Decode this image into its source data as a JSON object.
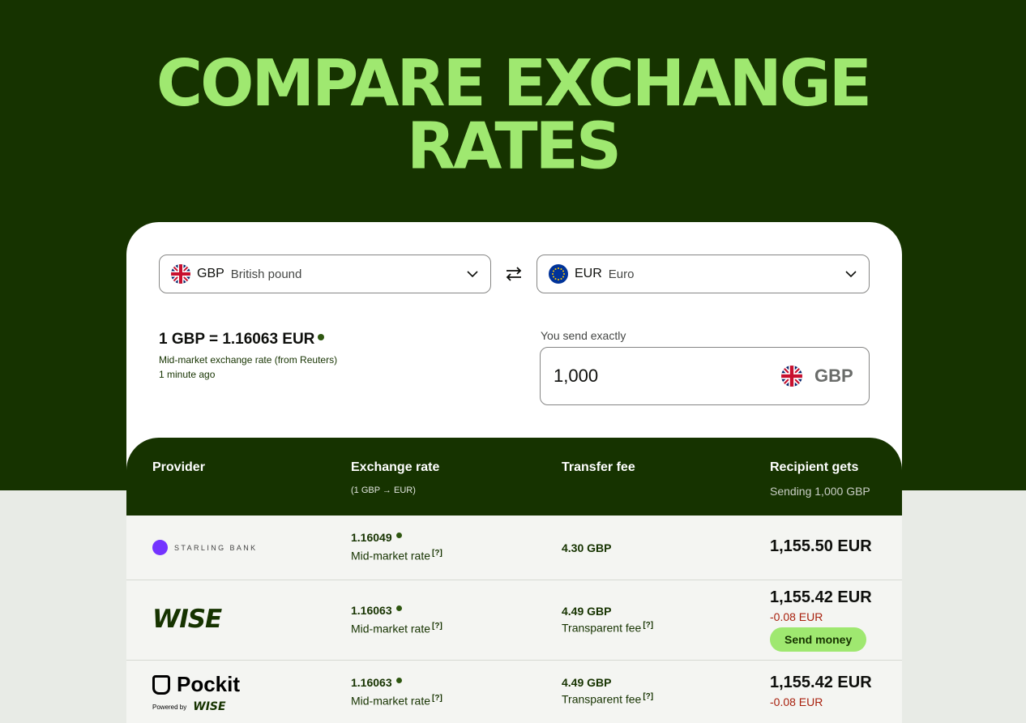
{
  "hero": {
    "title_line1": "COMPARE EXCHANGE",
    "title_line2": "RATES"
  },
  "converter": {
    "from": {
      "code": "GBP",
      "name": "British pound"
    },
    "to": {
      "code": "EUR",
      "name": "Euro"
    },
    "rate_text": "1 GBP = 1.16063 EUR",
    "rate_source": "Mid-market exchange rate (from Reuters)",
    "rate_updated": "1 minute ago",
    "send_label": "You send exactly",
    "send_amount": "1,000",
    "send_currency": "GBP"
  },
  "table": {
    "headers": {
      "provider": "Provider",
      "rate": "Exchange rate",
      "rate_sub": "(1 GBP → EUR)",
      "fee": "Transfer fee",
      "recipient": "Recipient gets",
      "recipient_sub": "Sending 1,000 GBP"
    },
    "rows": [
      {
        "provider": "STARLING BANK",
        "rate": "1.16049",
        "rate_label": "Mid-market rate",
        "q": "[?]",
        "fee": "4.30 GBP",
        "recipient": "1,155.50 EUR"
      },
      {
        "provider": "WISE",
        "rate": "1.16063",
        "rate_label": "Mid-market rate",
        "q": "[?]",
        "fee": "4.49 GBP",
        "fee_label": "Transparent fee",
        "recipient": "1,155.42 EUR",
        "diff": "-0.08 EUR",
        "action": "Send money"
      },
      {
        "provider": "Pockit",
        "powered_by": "Powered by",
        "powered_brand": "WISE",
        "rate": "1.16063",
        "rate_label": "Mid-market rate",
        "q": "[?]",
        "fee": "4.49 GBP",
        "fee_label": "Transparent fee",
        "recipient": "1,155.42 EUR",
        "diff": "-0.08 EUR"
      }
    ]
  },
  "colors": {
    "forest": "#163300",
    "lime": "#9fe870",
    "negative": "#a8200d",
    "starling": "#7433ff"
  },
  "icons": [
    "uk-flag-icon",
    "eu-flag-icon",
    "chevron-down-icon",
    "swap-icon",
    "status-dot-icon"
  ]
}
